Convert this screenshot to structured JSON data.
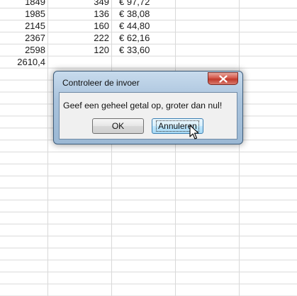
{
  "sheet": {
    "rows": [
      {
        "a": "1849",
        "b": "349",
        "c": "€ 97,72"
      },
      {
        "a": "1985",
        "b": "136",
        "c": "€ 38,08"
      },
      {
        "a": "2145",
        "b": "160",
        "c": "€ 44,80"
      },
      {
        "a": "2367",
        "b": "222",
        "c": "€ 62,16"
      },
      {
        "a": "2598",
        "b": "120",
        "c": "€ 33,60"
      },
      {
        "a": "2610,4",
        "b": "",
        "c": ""
      }
    ]
  },
  "dialog": {
    "title": "Controleer de invoer",
    "message": "Geef een geheel getal op, groter dan nul!",
    "ok_label": "OK",
    "cancel_label": "Annuleren"
  },
  "icons": {
    "close": "close-icon",
    "cursor": "mouse-pointer-icon"
  },
  "colors": {
    "close_button": "#c0392b",
    "dialog_frame": "#a9c3dc"
  }
}
